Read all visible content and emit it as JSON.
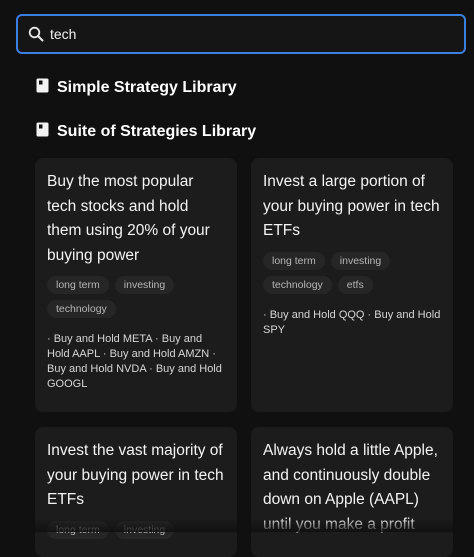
{
  "search": {
    "value": "tech"
  },
  "libraries": [
    {
      "label": "Simple Strategy Library"
    },
    {
      "label": "Suite of Strategies Library"
    }
  ],
  "cards": [
    {
      "title": "Buy the most popular tech stocks and hold them using 20% of your buying power",
      "tags": [
        "long term",
        "investing",
        "technology"
      ],
      "strategies": "· Buy and Hold META · Buy and Hold AAPL · Buy and Hold AMZN · Buy and Hold NVDA · Buy and Hold GOOGL"
    },
    {
      "title": "Invest a large portion of your buying power in tech ETFs",
      "tags": [
        "long term",
        "investing",
        "technology",
        "etfs"
      ],
      "strategies": "· Buy and Hold QQQ · Buy and Hold SPY"
    },
    {
      "title": "Invest the vast majority of your buying power in tech ETFs",
      "tags": [
        "long term",
        "investing"
      ],
      "strategies": ""
    },
    {
      "title": "Always hold a little Apple, and continuously double down on Apple (AAPL) until you make a profit",
      "tags": [],
      "strategies": ""
    }
  ],
  "icons": {
    "search": "search-icon",
    "library": "book-icon"
  },
  "colors": {
    "accent": "#3d7fe0",
    "background": "#101010",
    "card": "#1c1c1c",
    "tag": "#262626"
  }
}
